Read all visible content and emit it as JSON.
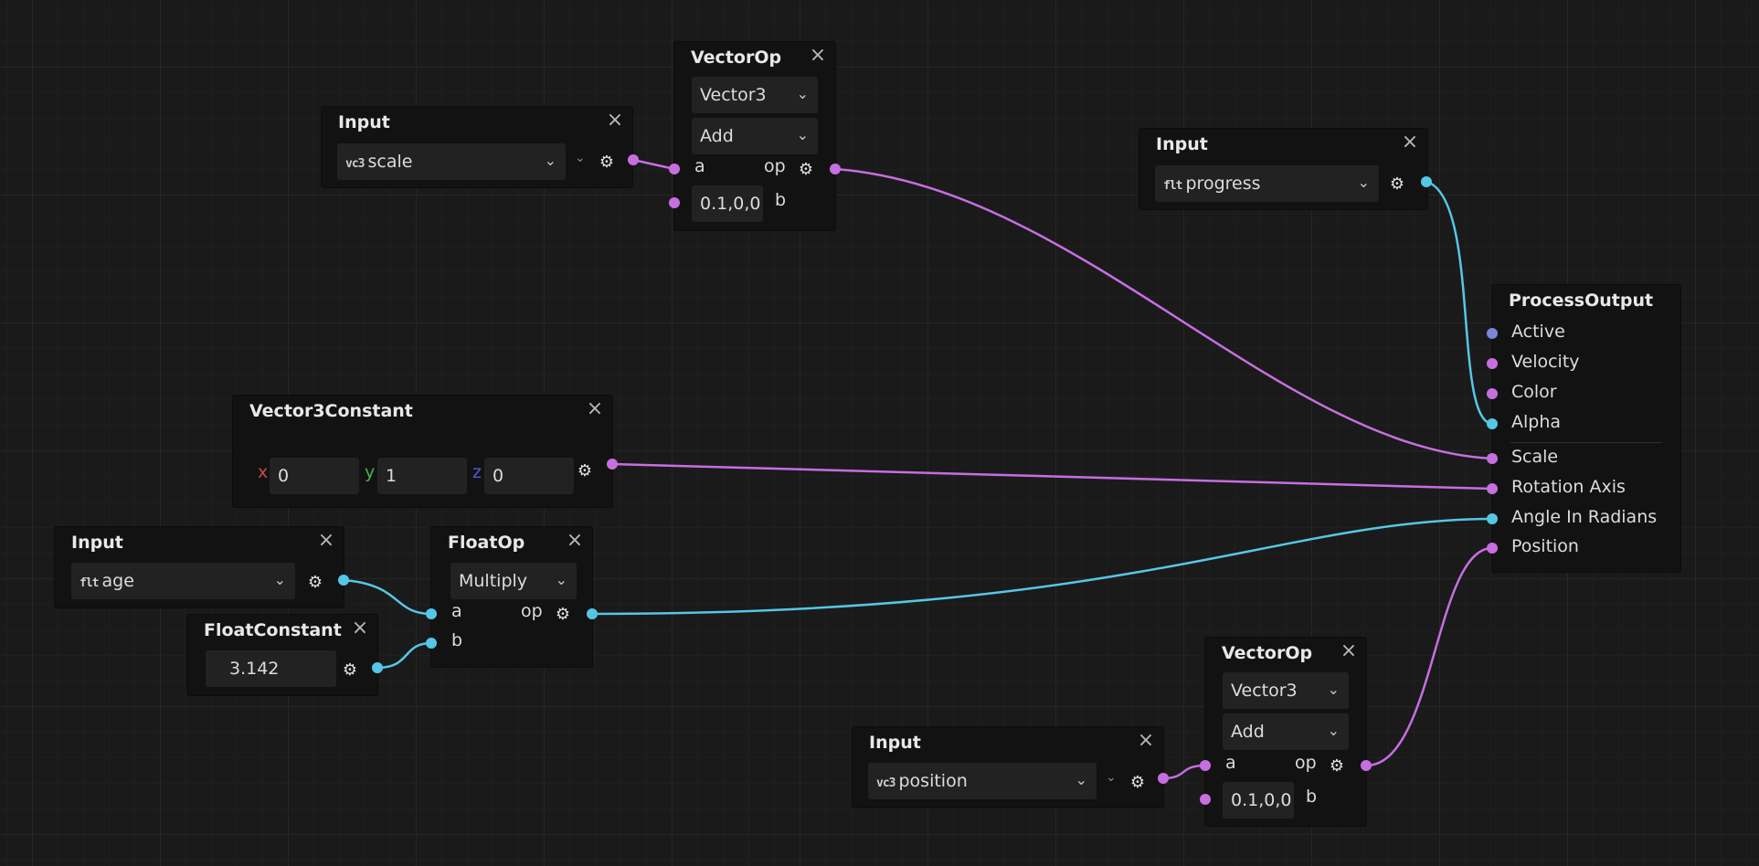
{
  "colors": {
    "vector_wire": "#c76ee0",
    "float_wire": "#55c7e6",
    "bool_port": "#7a86d9",
    "axis_x": "#c74a3c",
    "axis_y": "#4caf50",
    "axis_z": "#4a5ed9"
  },
  "icons": {
    "close": "×",
    "chevron": "⌄",
    "settings": "⚙"
  },
  "nodes": {
    "input_scale": {
      "title": "Input",
      "type_badge": "vc3",
      "value": "scale"
    },
    "vectorop_top": {
      "title": "VectorOp",
      "type_value": "Vector3",
      "op_value": "Add",
      "a_label": "a",
      "op_label": "op",
      "b_value": "0.1,0,0",
      "b_label": "b"
    },
    "input_progress": {
      "title": "Input",
      "type_badge": "flt",
      "value": "progress"
    },
    "process_output": {
      "title": "ProcessOutput",
      "ports": [
        "Active",
        "Velocity",
        "Color",
        "Alpha",
        "Scale",
        "Rotation Axis",
        "Angle In Radians",
        "Position"
      ]
    },
    "vector3_constant": {
      "title": "Vector3Constant",
      "x_label": "x",
      "x_value": "0",
      "y_label": "y",
      "y_value": "1",
      "z_label": "z",
      "z_value": "0"
    },
    "input_age": {
      "title": "Input",
      "type_badge": "flt",
      "value": "age"
    },
    "floatop": {
      "title": "FloatOp",
      "op_value": "Multiply",
      "a_label": "a",
      "op_label": "op",
      "b_label": "b"
    },
    "float_constant": {
      "title": "FloatConstant",
      "value": "3.142"
    },
    "vectorop_bottom": {
      "title": "VectorOp",
      "type_value": "Vector3",
      "op_value": "Add",
      "a_label": "a",
      "op_label": "op",
      "b_value": "0.1,0,0",
      "b_label": "b"
    },
    "input_position": {
      "title": "Input",
      "type_badge": "vc3",
      "value": "position"
    }
  }
}
